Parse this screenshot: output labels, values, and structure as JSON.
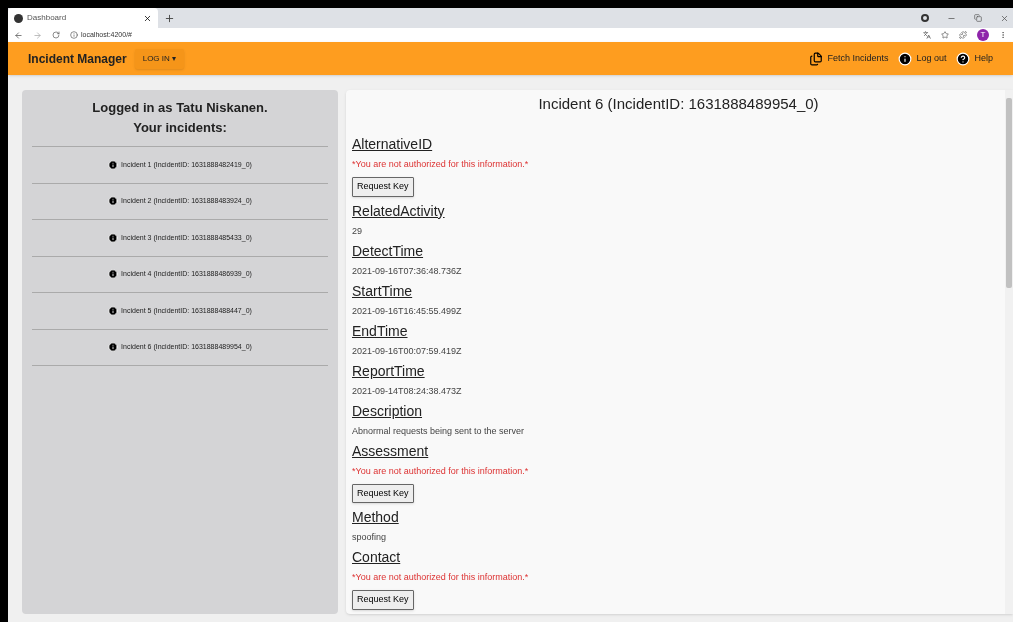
{
  "browser": {
    "tab_title": "Dashboard",
    "url": "localhost:4200/#",
    "profile_initial": "T"
  },
  "app_bar": {
    "title": "Incident Manager",
    "login_button": "LOG IN ▾",
    "actions": [
      {
        "kind": "fetch",
        "label": "Fetch Incidents"
      },
      {
        "kind": "logout",
        "label": "Log out"
      },
      {
        "kind": "help",
        "label": "Help"
      }
    ]
  },
  "sidebar": {
    "heading": [
      "Logged in as Tatu Niskanen.",
      "Your incidents:"
    ],
    "items": [
      {
        "label": "Incident 1 (IncidentID: 1631888482419_0)",
        "selected": false
      },
      {
        "label": "Incident 2 (IncidentID: 1631888483924_0)",
        "selected": false
      },
      {
        "label": "Incident 3 (IncidentID: 1631888485433_0)",
        "selected": false
      },
      {
        "label": "Incident 4 (IncidentID: 1631888486939_0)",
        "selected": false
      },
      {
        "label": "Incident 5 (IncidentID: 1631888488447_0)",
        "selected": false
      },
      {
        "label": "Incident 6 (IncidentID: 1631888489954_0)",
        "selected": false
      }
    ]
  },
  "detail": {
    "title": "Incident 6 (IncidentID: 1631888489954_0)",
    "fields": [
      {
        "kind": "restricted",
        "label": "AlternativeID",
        "message": "*You are not authorized for this information.*",
        "button": "Request Key"
      },
      {
        "kind": "value",
        "label": "RelatedActivity",
        "value": "29"
      },
      {
        "kind": "value",
        "label": "DetectTime",
        "value": "2021-09-16T07:36:48.736Z"
      },
      {
        "kind": "value",
        "label": "StartTime",
        "value": "2021-09-16T16:45:55.499Z"
      },
      {
        "kind": "value",
        "label": "EndTime",
        "value": "2021-09-16T00:07:59.419Z"
      },
      {
        "kind": "value",
        "label": "ReportTime",
        "value": "2021-09-14T08:24:38.473Z"
      },
      {
        "kind": "value",
        "label": "Description",
        "value": "Abnormal requests being sent to the server"
      },
      {
        "kind": "restricted",
        "label": "Assessment",
        "message": "*You are not authorized for this information.*",
        "button": "Request Key"
      },
      {
        "kind": "value",
        "label": "Method",
        "value": "spoofing"
      },
      {
        "kind": "restricted",
        "label": "Contact",
        "message": "*You are not authorized for this information.*",
        "button": "Request Key"
      }
    ]
  }
}
